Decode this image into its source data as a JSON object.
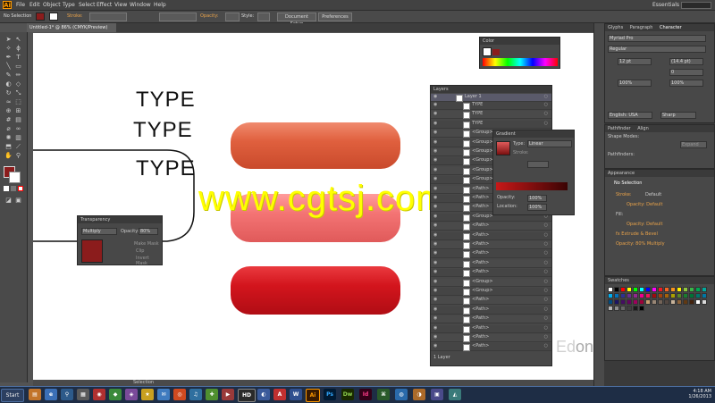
{
  "app": {
    "logo": "Ai",
    "essentials": "Essentials"
  },
  "menu": [
    "File",
    "Edit",
    "Object",
    "Type",
    "Select",
    "Effect",
    "View",
    "Window",
    "Help"
  ],
  "control": {
    "selection": "No Selection",
    "stroke": "Stroke:",
    "opacity": "Opacity:",
    "style": "Style:",
    "doc_setup": "Document Setup",
    "preferences": "Preferences"
  },
  "tab": {
    "title": "Untitled-1* @ 86% (CMYK/Preview)"
  },
  "canvas": {
    "words": [
      "TYPE",
      "TYPE",
      "TYPE"
    ],
    "watermark": "www.cgtsj.com"
  },
  "colors": {
    "pill_top": "#e0603e",
    "pill_mid": "#f47474",
    "pill_bottom": "#d3151d"
  },
  "transparency": {
    "title": "Transparency",
    "mode": "Multiply",
    "opacity_label": "Opacity:",
    "opacity": "80%",
    "make_mask": "Make Mask",
    "clip": "Clip",
    "invert": "Invert Mask"
  },
  "color_panel": {
    "title": "Color"
  },
  "layers": {
    "title": "Layers",
    "top": "Layer 1",
    "rows": [
      "TYPE",
      "TYPE",
      "TYPE",
      "<Group>",
      "<Group>",
      "<Group>",
      "<Group>",
      "<Group>",
      "<Group>",
      "<Path>",
      "<Path>",
      "<Path>",
      "<Group>",
      "<Path>",
      "<Path>",
      "<Path>",
      "<Path>",
      "<Path>",
      "<Path>",
      "<Group>",
      "<Group>",
      "<Path>",
      "<Path>",
      "<Path>",
      "<Path>",
      "<Path>",
      "<Path>"
    ],
    "footer": "1 Layer"
  },
  "gradient": {
    "title": "Gradient",
    "type_label": "Type:",
    "type": "Linear",
    "stroke_label": "Stroke:",
    "opacity_label": "Opacity:",
    "opacity": "100%",
    "location_label": "Location:",
    "location": "100%"
  },
  "char_panel": {
    "tabs": [
      "Glyphs",
      "Paragraph",
      "Character"
    ],
    "font": "Myriad Pro",
    "style": "Regular",
    "size": "12 pt",
    "leading": "(14.4 pt)",
    "tracking": "0",
    "scale_h": "100%",
    "scale_v": "100%",
    "language": "English: USA",
    "aa": "Sharp"
  },
  "pathfinder": {
    "tabs": [
      "Pathfinder",
      "Align"
    ],
    "shape_modes": "Shape Modes:",
    "expand": "Expand",
    "pathfinders": "Pathfinders:"
  },
  "appearance": {
    "title": "Appearance",
    "none": "No Selection",
    "stroke": "Stroke:",
    "stroke_val": "Default",
    "opacity1": "Opacity: Default",
    "fill": "Fill:",
    "opacity2": "Opacity: Default",
    "effect": "fx Extrude & Bevel",
    "opacity3": "Opacity: 80% Multiply"
  },
  "swatches": {
    "title": "Swatches",
    "colors": [
      "#ffffff",
      "#000000",
      "#ff0000",
      "#ffff00",
      "#00ff00",
      "#00ffff",
      "#0000ff",
      "#ff00ff",
      "#ed1c24",
      "#f26522",
      "#f7941d",
      "#fff200",
      "#8dc63f",
      "#39b54a",
      "#00a651",
      "#00a99d",
      "#00aeef",
      "#0072bc",
      "#2e3192",
      "#662d91",
      "#92278f",
      "#ec008c",
      "#ed145b",
      "#9e0b0f",
      "#a0410d",
      "#a36209",
      "#aba000",
      "#598527",
      "#1a7b30",
      "#007236",
      "#00746b",
      "#0076a3",
      "#004b80",
      "#1b1464",
      "#440e62",
      "#630460",
      "#9e005d",
      "#9e0039",
      "#c69c6d",
      "#998675",
      "#736357",
      "#534741",
      "#c7b299",
      "#8c6239",
      "#603913",
      "#42210b",
      "#ffffff",
      "#d9d9d9",
      "#b3b3b3",
      "#8c8c8c",
      "#666666",
      "#404040",
      "#1a1a1a",
      "#000000"
    ]
  },
  "edu": {
    "text": "onix",
    "prefix": "Ed"
  },
  "status": {
    "text": "Selection"
  },
  "taskbar": {
    "start": "Start",
    "icons": [
      "HD",
      "Ai",
      "Ps",
      "Dw",
      "Id"
    ],
    "time": "4:18 AM",
    "date": "1/26/2013"
  }
}
